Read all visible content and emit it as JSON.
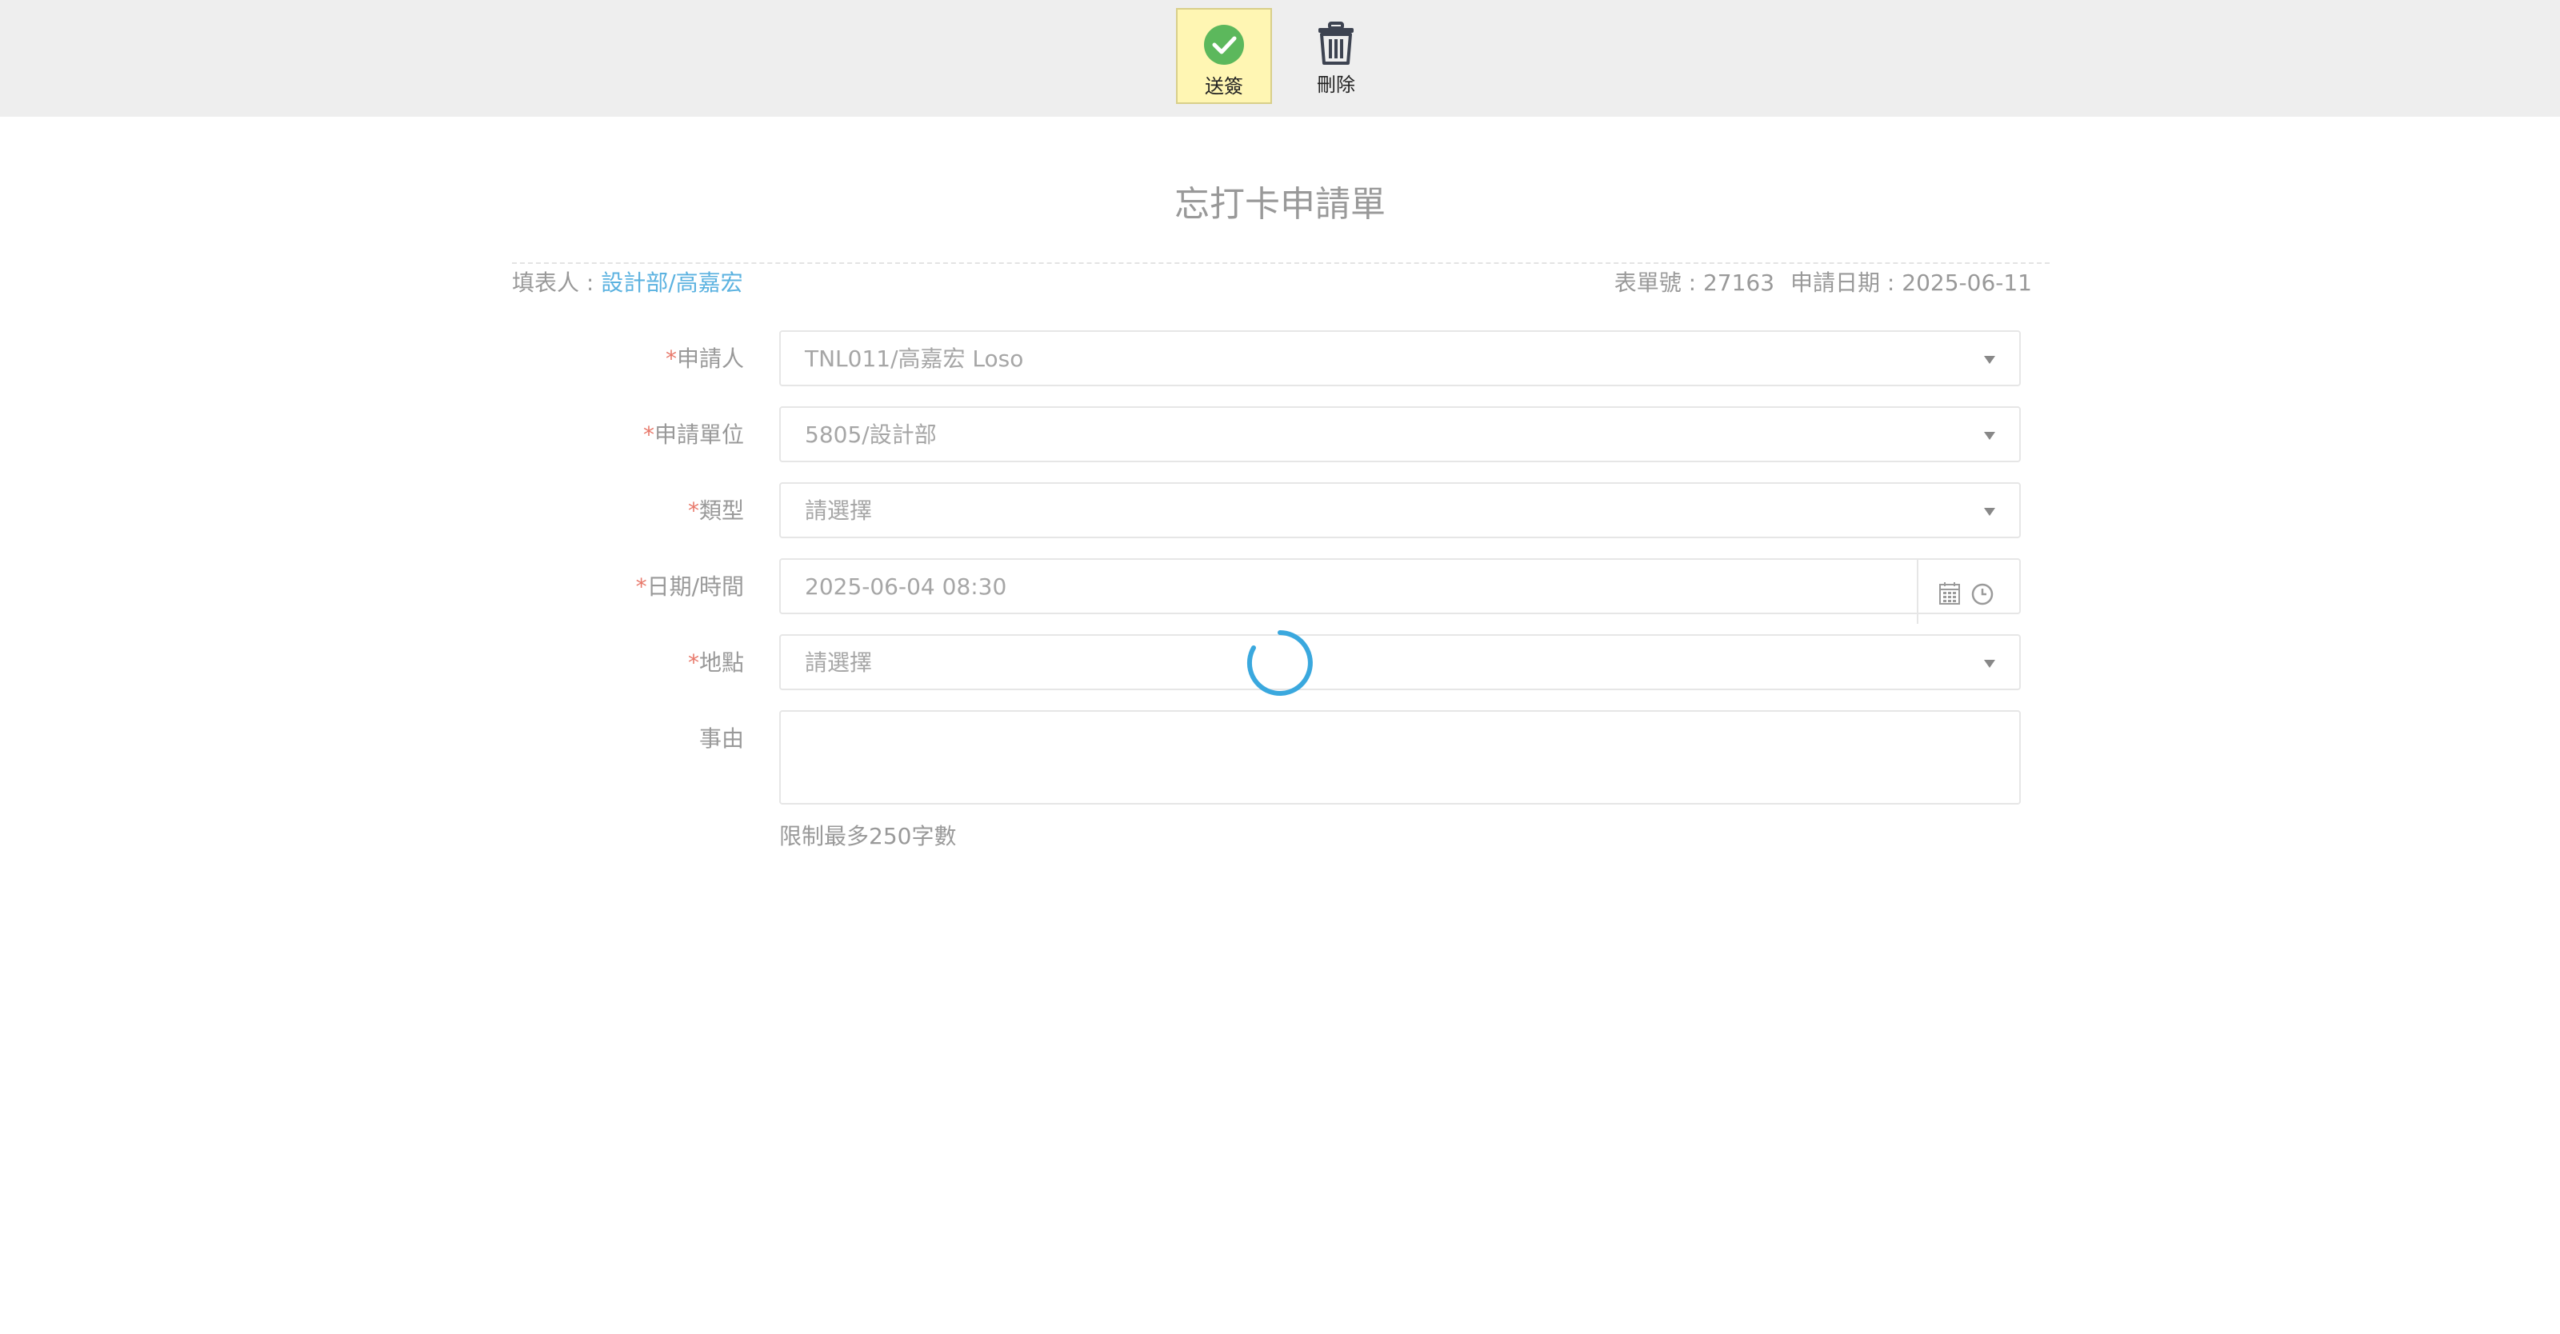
{
  "toolbar": {
    "submit_label": "送簽",
    "delete_label": "刪除"
  },
  "form": {
    "title": "忘打卡申請單",
    "filler_label": "填表人 : ",
    "filler_value": "設計部/高嘉宏",
    "form_no": "表單號 : 27163",
    "apply_date": "申請日期 : 2025-06-11",
    "required_mark": "*",
    "fields": {
      "applicant": {
        "label": "申請人",
        "value": "TNL011/高嘉宏 Loso"
      },
      "unit": {
        "label": "申請單位",
        "value": "5805/設計部"
      },
      "type": {
        "label": "類型",
        "value": "請選擇"
      },
      "datetime": {
        "label": "日期/時間",
        "value": "2025-06-04 08:30"
      },
      "location": {
        "label": "地點",
        "value": "請選擇"
      },
      "reason": {
        "label": "事由",
        "value": ""
      }
    },
    "reason_hint": "限制最多250字數"
  },
  "colors": {
    "accent": "#5bb2e0",
    "required": "#e8786a",
    "submit_bg": "#fff6b3",
    "check_green": "#5cb85c",
    "spinner": "#3aa8de"
  },
  "icons": {
    "submit": "check-circle-icon",
    "delete": "trash-icon",
    "calendar": "calendar-icon",
    "clock": "clock-icon",
    "loading": "loading-spinner"
  }
}
